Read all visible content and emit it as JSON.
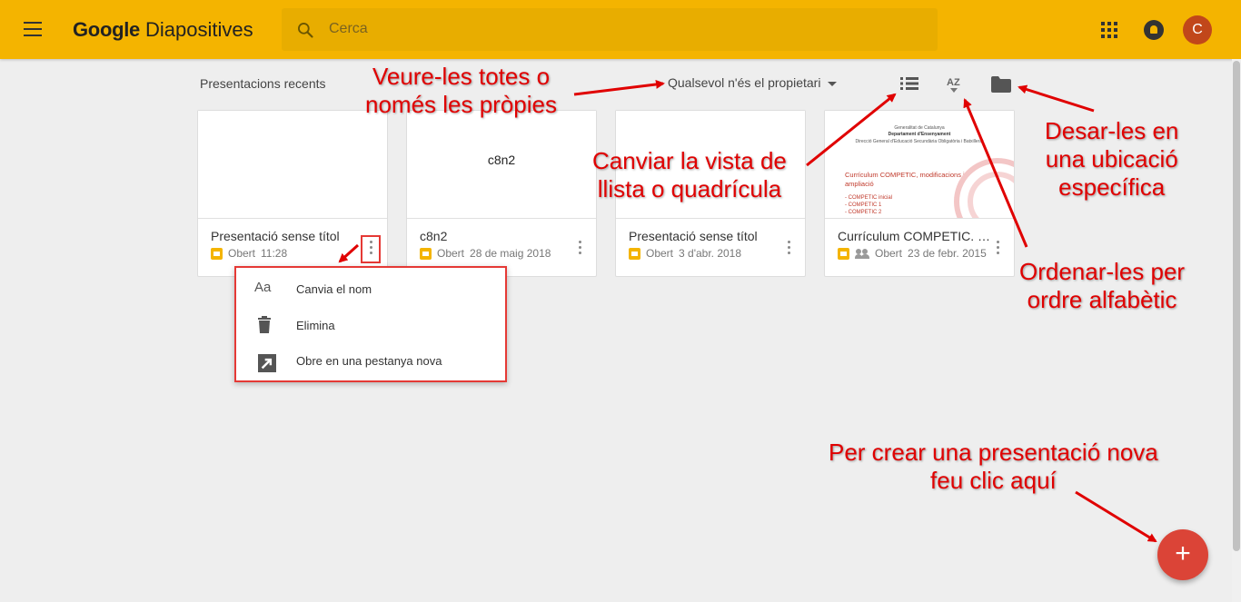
{
  "app": {
    "logo_brand": "Google",
    "logo_product": "Diapositives",
    "search_placeholder": "Cerca",
    "avatar_letter": "C",
    "header_color": "#f4b400",
    "accent_red": "#db4437"
  },
  "toolbar": {
    "recent_label": "Presentacions recents",
    "owner_filter": "Qualsevol n'és el propietari",
    "sort_label": "AZ"
  },
  "cards": [
    {
      "title": "Presentació sense títol",
      "status": "Obert",
      "date": "11:28",
      "thumb_text": ""
    },
    {
      "title": "c8n2",
      "status": "Obert",
      "date": "28 de maig 2018",
      "thumb_text": "c8n2"
    },
    {
      "title": "Presentació sense títol",
      "status": "Obert",
      "date": "3 d'abr. 2018",
      "thumb_text": ""
    },
    {
      "title": "Currículum COMPETIC. M...",
      "status": "Obert",
      "date": "23 de febr. 2015",
      "thumb_text": "",
      "shared": true,
      "thumb_doc": {
        "line1": "Generalitat de Catalunya",
        "line2": "Departament d'Ensenyament",
        "line3": "Direcció General d'Educació Secundària Obligatòria i Batxillerat",
        "title": "Currículum COMPETIC, modificacions i ampliació",
        "bullets": [
          "- COMPETIC inicial",
          "- COMPETIC 1",
          "- COMPETIC 2"
        ]
      }
    }
  ],
  "context_menu": {
    "items": [
      {
        "icon": "text-format-icon",
        "glyph": "Aa",
        "label": "Canvia el nom"
      },
      {
        "icon": "trash-icon",
        "glyph": "",
        "label": "Elimina"
      },
      {
        "icon": "open-new-tab-icon",
        "glyph": "",
        "label": "Obre en una pestanya nova"
      }
    ]
  },
  "annotations": {
    "owner": [
      "Veure-les totes o",
      "només les pròpies"
    ],
    "view": [
      "Canviar la vista de",
      "llista o quadrícula"
    ],
    "folder": [
      "Desar-les en",
      "una ubicació",
      "específica"
    ],
    "sort": [
      "Ordenar-les per",
      "ordre alfabètic"
    ],
    "create": [
      "Per crear una presentació nova",
      "feu clic aquí"
    ]
  },
  "fab": {
    "label": "+"
  }
}
